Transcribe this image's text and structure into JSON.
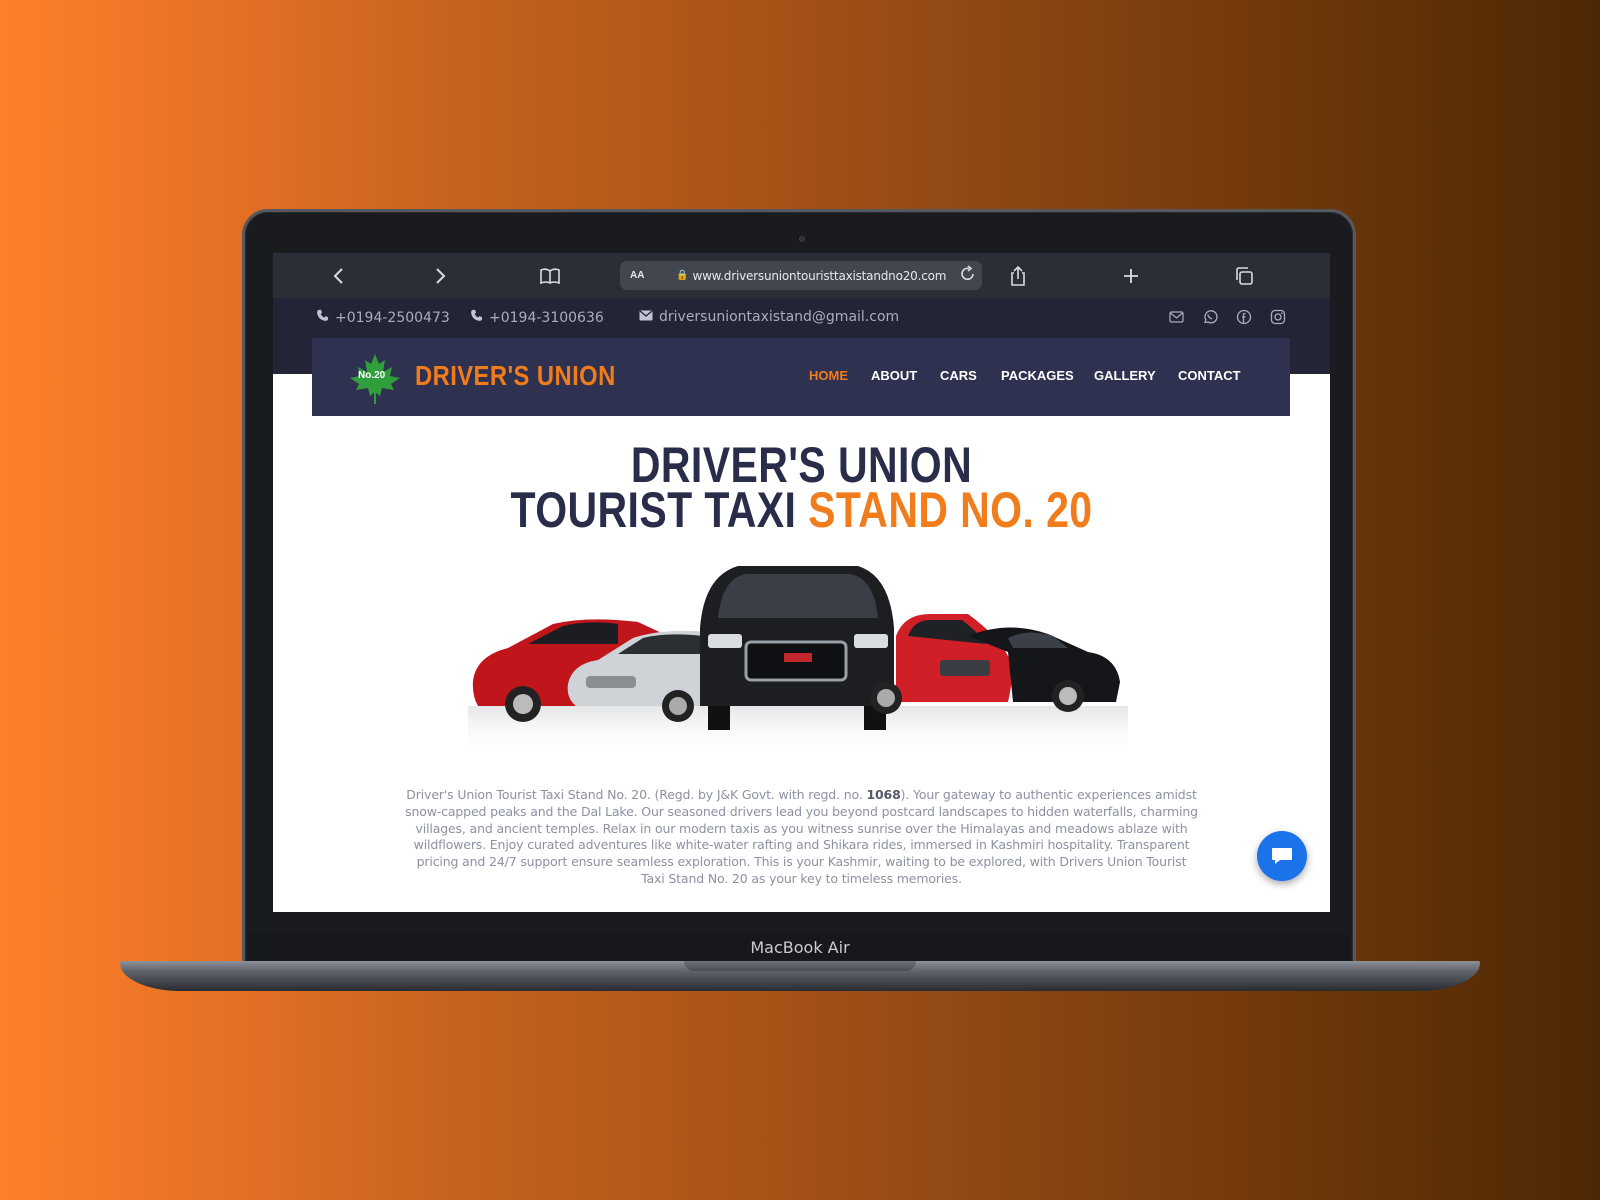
{
  "device": {
    "brand": "MacBook Air"
  },
  "browser": {
    "url": "www.driversuniontouristtaxistandno20.com",
    "text_size_label": "AA"
  },
  "topbar": {
    "phone1": "+0194-2500473",
    "phone2": "+0194-3100636",
    "email": "driversuniontaxistand@gmail.com"
  },
  "logo": {
    "badge": "No.20",
    "text": "DRIVER'S UNION"
  },
  "nav": {
    "items": [
      {
        "label": "HOME"
      },
      {
        "label": "ABOUT"
      },
      {
        "label": "CARS"
      },
      {
        "label": "PACKAGES"
      },
      {
        "label": "GALLERY"
      },
      {
        "label": "CONTACT"
      }
    ],
    "active": "HOME"
  },
  "hero": {
    "line1": "DRIVER'S UNION",
    "line2_prefix": "TOURIST TAXI ",
    "line2_accent": "STAND NO. 20"
  },
  "description": {
    "part1": "Driver's Union Tourist Taxi Stand No. 20. (Regd. by J&K Govt. with regd. no. ",
    "reg_no": "1068",
    "part2": "). Your gateway to authentic experiences amidst snow-capped peaks and the Dal Lake. Our seasoned drivers lead you beyond postcard landscapes to hidden waterfalls, charming villages, and ancient temples. Relax in our modern taxis as you witness sunrise over the Himalayas and meadows ablaze with wildflowers. Enjoy curated adventures like white-water rafting and Shikara rides, immersed in Kashmiri hospitality. Transparent pricing and 24/7 support ensure seamless exploration. This is your Kashmir, waiting to be explored, with Drivers Union Tourist Taxi Stand No. 20 as your key to timeless memories."
  },
  "colors": {
    "accent": "#f07c1c",
    "navy": "#2e3150",
    "topbar": "#232537",
    "chat": "#1a73e8"
  }
}
